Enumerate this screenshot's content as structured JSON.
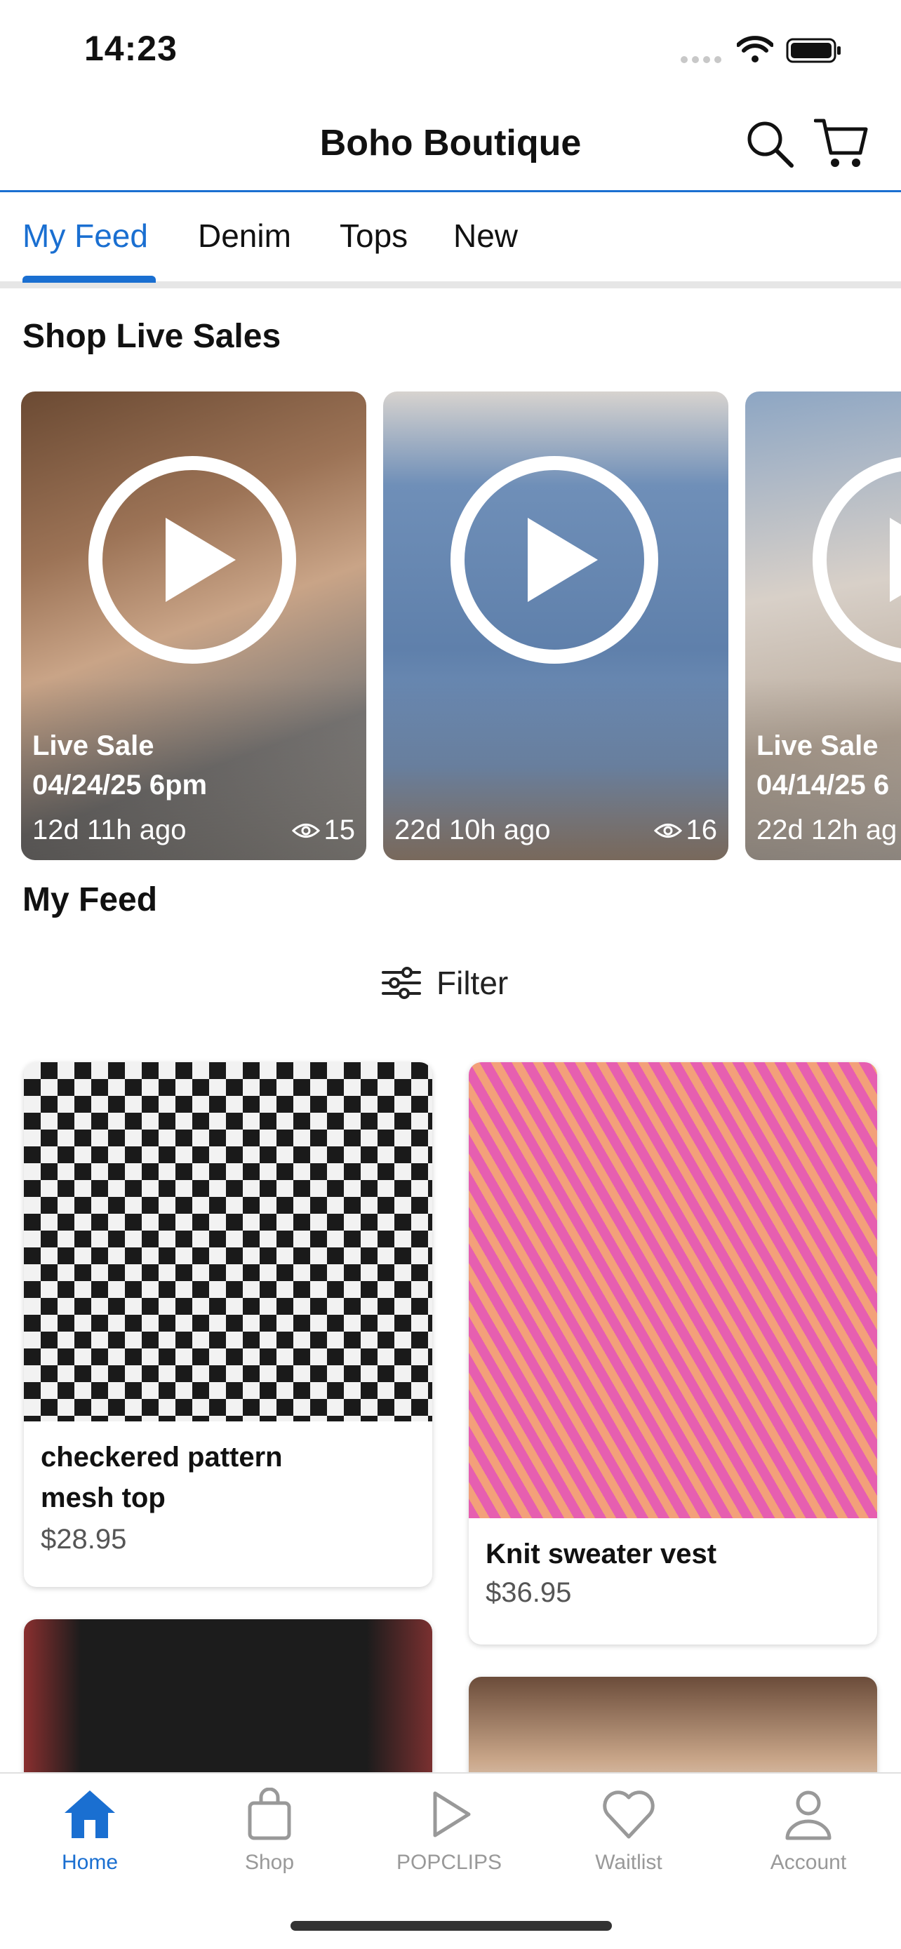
{
  "status_bar": {
    "time": "14:23"
  },
  "header": {
    "title": "Boho Boutique"
  },
  "tabs": [
    {
      "label": "My Feed",
      "active": true
    },
    {
      "label": "Denim",
      "active": false
    },
    {
      "label": "Tops",
      "active": false
    },
    {
      "label": "New",
      "active": false
    }
  ],
  "live_section": {
    "title": "Shop Live Sales",
    "cards": [
      {
        "label": "Live Sale",
        "date": "04/24/25 6pm",
        "ago": "12d 11h ago",
        "views": "15"
      },
      {
        "label": "",
        "date": "",
        "ago": "22d 10h ago",
        "views": "16"
      },
      {
        "label": "Live Sale",
        "date": "04/14/25 6",
        "ago": "22d 12h ag",
        "views": ""
      }
    ]
  },
  "feed": {
    "title": "My Feed",
    "filter_label": "Filter",
    "products": [
      {
        "name_line1": "checkered pattern",
        "name_line2": "mesh top",
        "price": "$28.95"
      },
      {
        "name_line1": "Knit sweater vest",
        "name_line2": "",
        "price": "$36.95"
      }
    ]
  },
  "bottom_nav": [
    {
      "label": "Home",
      "icon": "home-icon",
      "active": true
    },
    {
      "label": "Shop",
      "icon": "shopping-bag-icon",
      "active": false
    },
    {
      "label": "POPCLIPS",
      "icon": "play-icon",
      "active": false
    },
    {
      "label": "Waitlist",
      "icon": "heart-icon",
      "active": false
    },
    {
      "label": "Account",
      "icon": "person-icon",
      "active": false
    }
  ],
  "colors": {
    "accent": "#1a6fd1",
    "text": "#111111",
    "muted": "#999999"
  }
}
